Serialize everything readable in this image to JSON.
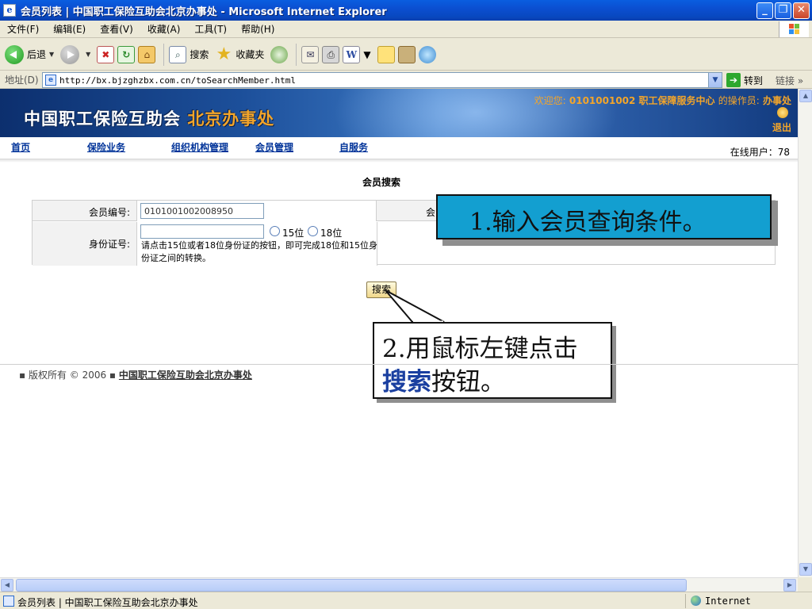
{
  "window": {
    "title": "会员列表 | 中国职工保险互助会北京办事处 - Microsoft Internet Explorer",
    "minimize": "_",
    "maximize": "❐",
    "close": "✕"
  },
  "menu": [
    "文件(F)",
    "编辑(E)",
    "查看(V)",
    "收藏(A)",
    "工具(T)",
    "帮助(H)"
  ],
  "toolbar": {
    "back_label": "后退",
    "search_label": "搜索",
    "favorites_label": "收藏夹"
  },
  "address": {
    "label": "地址(D)",
    "url": "http://bx.bjzghzbx.com.cn/toSearchMember.html",
    "go_label": "转到",
    "links_label": "链接"
  },
  "banner": {
    "org_name": "中国职工保险互助会",
    "office_name": "北京办事处",
    "welcome_prefix": "欢迎您:",
    "welcome_org": "0101001002 职工保障服务中心",
    "operator_prefix": "的操作员:",
    "operator_name": "办事处",
    "logout_label": "退出"
  },
  "nav": {
    "items": [
      "首页",
      "保险业务",
      "组织机构管理",
      "会员管理",
      "自服务"
    ],
    "online_users": "在线用户：78"
  },
  "search_form": {
    "heading": "会员搜索",
    "member_no_label": "会员编号:",
    "member_no_value": "0101001002008950",
    "right_label": "会员",
    "id_label": "身份证号:",
    "id_value": "",
    "radio_15": "15位",
    "radio_18": "18位",
    "id_hint": "请点击15位或者18位身份证的按钮，即可完成18位和15位身份证之间的转换。",
    "search_button": "搜索"
  },
  "callouts": {
    "step1": "1.输入会员查询条件。",
    "step2_line1": "2.用鼠标左键点击",
    "step2_keyword": "搜索",
    "step2_suffix": "按钮。"
  },
  "footer": {
    "copyright": "▪ 版权所有 © 2006 ▪",
    "org_link": "中国职工保险互助会北京办事处"
  },
  "status": {
    "text": "会员列表 | 中国职工保险互助会北京办事处",
    "zone": "Internet"
  }
}
